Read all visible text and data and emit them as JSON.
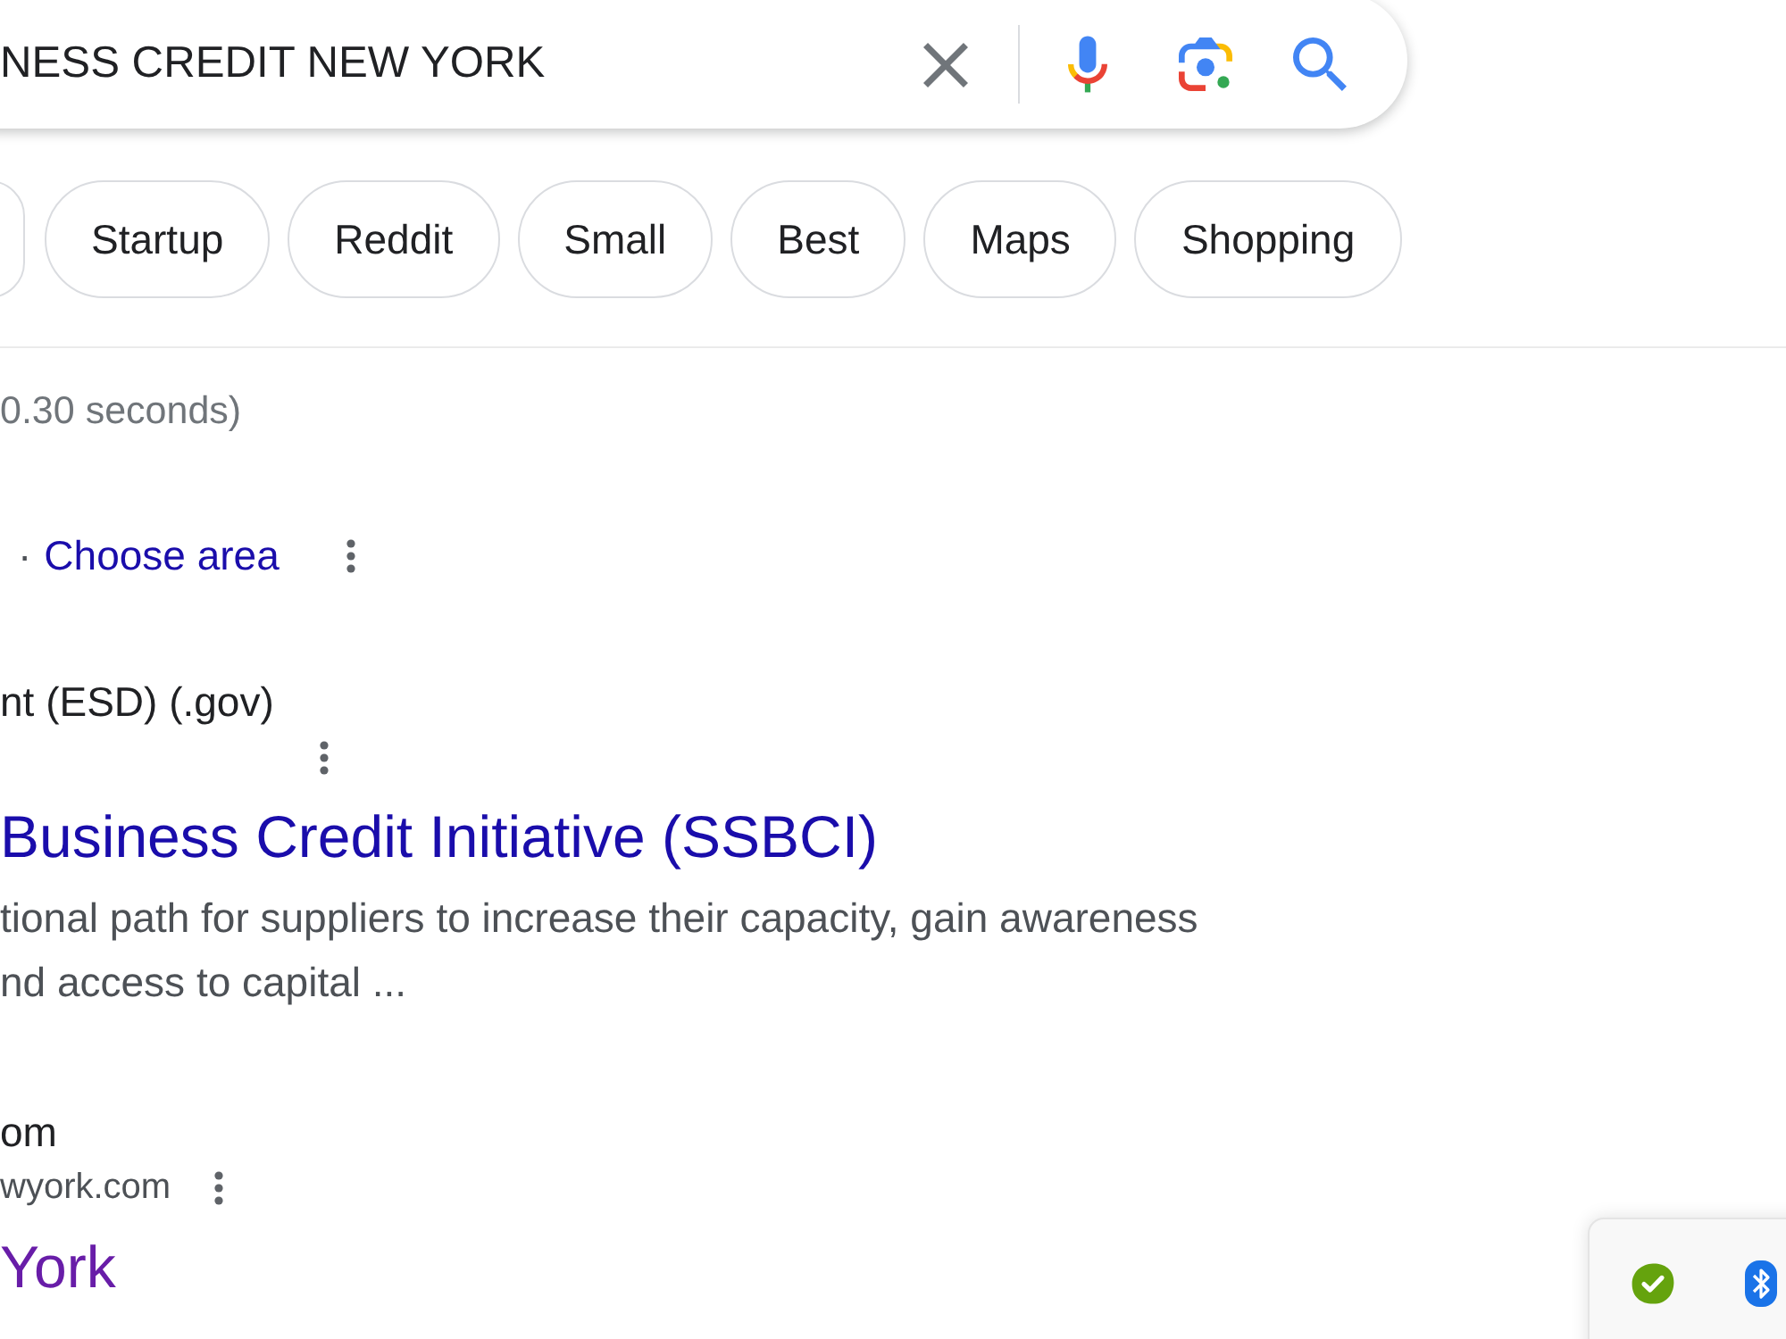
{
  "search_bar": {
    "query": "NESS CREDIT NEW YORK"
  },
  "filter_chips": [
    {
      "label": "Startup"
    },
    {
      "label": "Reddit"
    },
    {
      "label": "Small"
    },
    {
      "label": "Best"
    },
    {
      "label": "Maps"
    },
    {
      "label": "Shopping"
    }
  ],
  "result_stats": "0.30 seconds)",
  "location": {
    "separator": "·",
    "link": "Choose area"
  },
  "results": [
    {
      "source": "nt (ESD) (.gov)",
      "title": "Business Credit Initiative (SSBCI)",
      "visited": false,
      "snippet_lines": [
        "tional path for suppliers to increase their capacity, gain awareness",
        "nd access to capital ..."
      ]
    },
    {
      "source": "om",
      "url": "wyork.com",
      "title": "York",
      "visited": true
    }
  ]
}
